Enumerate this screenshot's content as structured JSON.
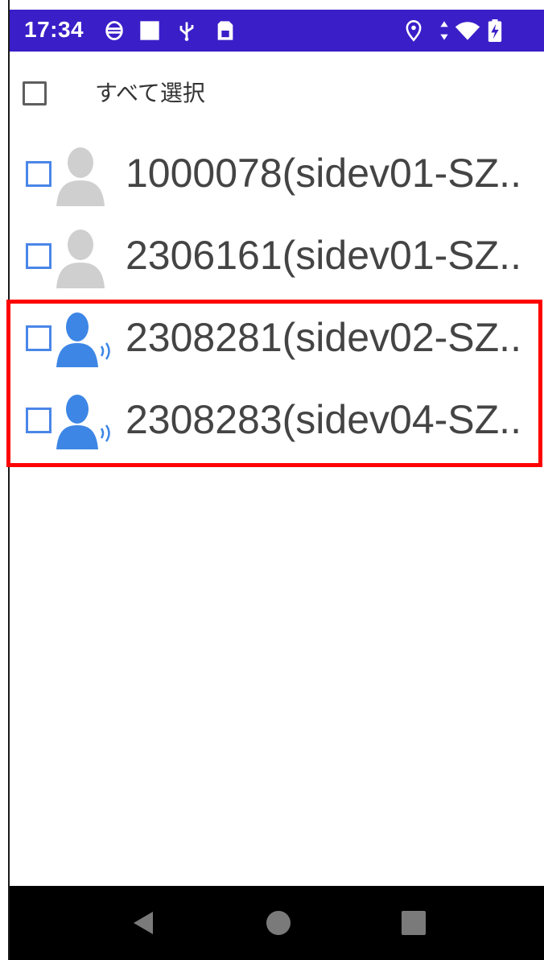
{
  "status_bar": {
    "time": "17:34",
    "background": "#3a1ec8",
    "icons_left": [
      "settings-icon",
      "notification-square-icon",
      "usb-icon",
      "sim-card-icon"
    ],
    "icons_right": [
      "location-icon",
      "data-arrows-icon",
      "wifi-icon",
      "battery-charging-icon"
    ]
  },
  "select_all": {
    "label": "すべて選択",
    "checked": false
  },
  "users": [
    {
      "label": "1000078(sidev01-SZ..",
      "status": "offline",
      "checked": false
    },
    {
      "label": "2306161(sidev01-SZ..",
      "status": "offline",
      "checked": false
    },
    {
      "label": "2308281(sidev02-SZ..",
      "status": "online",
      "checked": false
    },
    {
      "label": "2308283(sidev04-SZ..",
      "status": "online",
      "checked": false
    }
  ],
  "colors": {
    "accent": "#4a86e8",
    "offline_avatar": "#cfcfcf",
    "online_avatar": "#3d86e6",
    "highlight": "#ff0000"
  },
  "nav_bar": {
    "buttons": [
      "back-icon",
      "home-icon",
      "recents-icon"
    ]
  }
}
